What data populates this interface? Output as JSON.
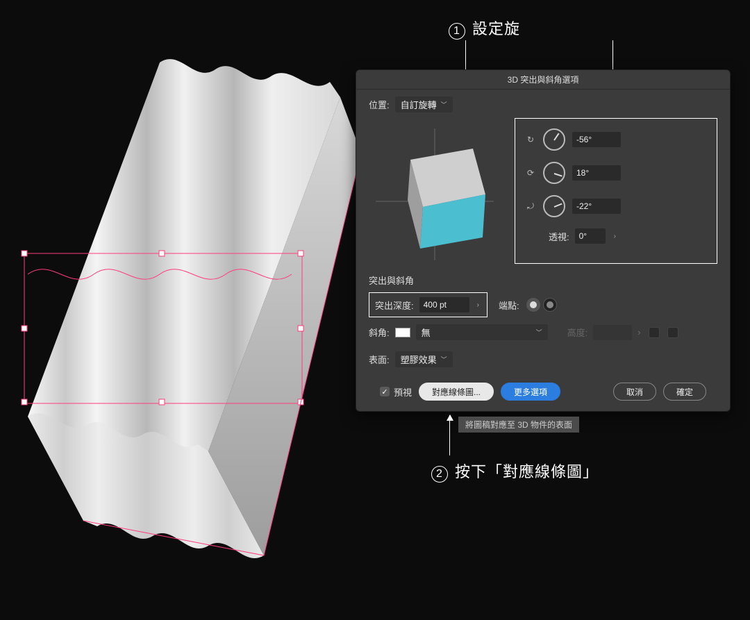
{
  "annotations": {
    "step1": "設定旋",
    "step2": "按下「對應線條圖」"
  },
  "dialog": {
    "title": "3D 突出與斜角選項",
    "position_label": "位置:",
    "position_value": "自訂旋轉",
    "rotation": {
      "x": "-56°",
      "y": "18°",
      "z": "-22°"
    },
    "perspective_label": "透視:",
    "perspective_value": "0°",
    "section_extrude": "突出與斜角",
    "extrude_depth_label": "突出深度:",
    "extrude_depth_value": "400 pt",
    "cap_label": "端點:",
    "bevel_label": "斜角:",
    "bevel_value": "無",
    "bevel_height_label": "高度:",
    "surface_label": "表面:",
    "surface_value": "塑膠效果",
    "preview_label": "預視",
    "btn_map": "對應線條圖...",
    "btn_more": "更多選項",
    "btn_cancel": "取消",
    "btn_ok": "確定"
  },
  "tooltip": "將圖稿對應至 3D 物件的表面"
}
